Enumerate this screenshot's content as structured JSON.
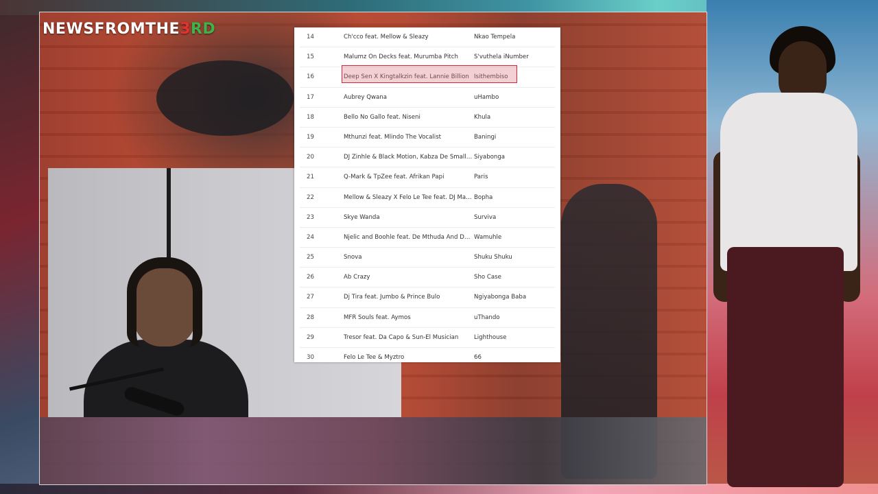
{
  "logo": {
    "part1": "NEWSFROMTHE",
    "part2": "3",
    "part3": "RD"
  },
  "table": {
    "highlight_color": "#d0283a",
    "rows": [
      {
        "num": "14",
        "artist": "Ch'cco feat. Mellow & Sleazy",
        "song": "Nkao Tempela"
      },
      {
        "num": "15",
        "artist": "Malumz On Decks feat. Murumba Pitch",
        "song": "S'vuthela iNumber"
      },
      {
        "num": "16",
        "artist": "Deep Sen X Kingtalkzin feat. Lannie Billion",
        "song": "Isithembiso"
      },
      {
        "num": "17",
        "artist": "Aubrey Qwana",
        "song": "uHambo"
      },
      {
        "num": "18",
        "artist": "Bello No Gallo feat. Niseni",
        "song": "Khula"
      },
      {
        "num": "19",
        "artist": "Mthunzi feat. Mlindo The Vocalist",
        "song": "Baningi"
      },
      {
        "num": "20",
        "artist": "DJ Zinhle & Black Motion, Kabza De Small & Nok...",
        "song": "Siyabonga"
      },
      {
        "num": "21",
        "artist": "Q-Mark & TpZee feat. Afrikan Papi",
        "song": "Paris"
      },
      {
        "num": "22",
        "artist": "Mellow & Sleazy X Felo Le Tee feat. DJ Maphoris...",
        "song": "Bopha"
      },
      {
        "num": "23",
        "artist": "Skye Wanda",
        "song": "Surviva"
      },
      {
        "num": "24",
        "artist": "Njelic and Boohle feat. De Mthuda And Da Muziq...",
        "song": "Wamuhle"
      },
      {
        "num": "25",
        "artist": "Snova",
        "song": "Shuku Shuku"
      },
      {
        "num": "26",
        "artist": "Ab Crazy",
        "song": "Sho Case"
      },
      {
        "num": "27",
        "artist": "Dj Tira feat. Jumbo & Prince Bulo",
        "song": "Ngiyabonga Baba"
      },
      {
        "num": "28",
        "artist": "MFR Souls feat. Aymos",
        "song": "uThando"
      },
      {
        "num": "29",
        "artist": "Tresor feat. Da Capo & Sun-El Musician",
        "song": "Lighthouse"
      },
      {
        "num": "30",
        "artist": "Felo Le Tee & Myztro",
        "song": "66"
      }
    ]
  }
}
